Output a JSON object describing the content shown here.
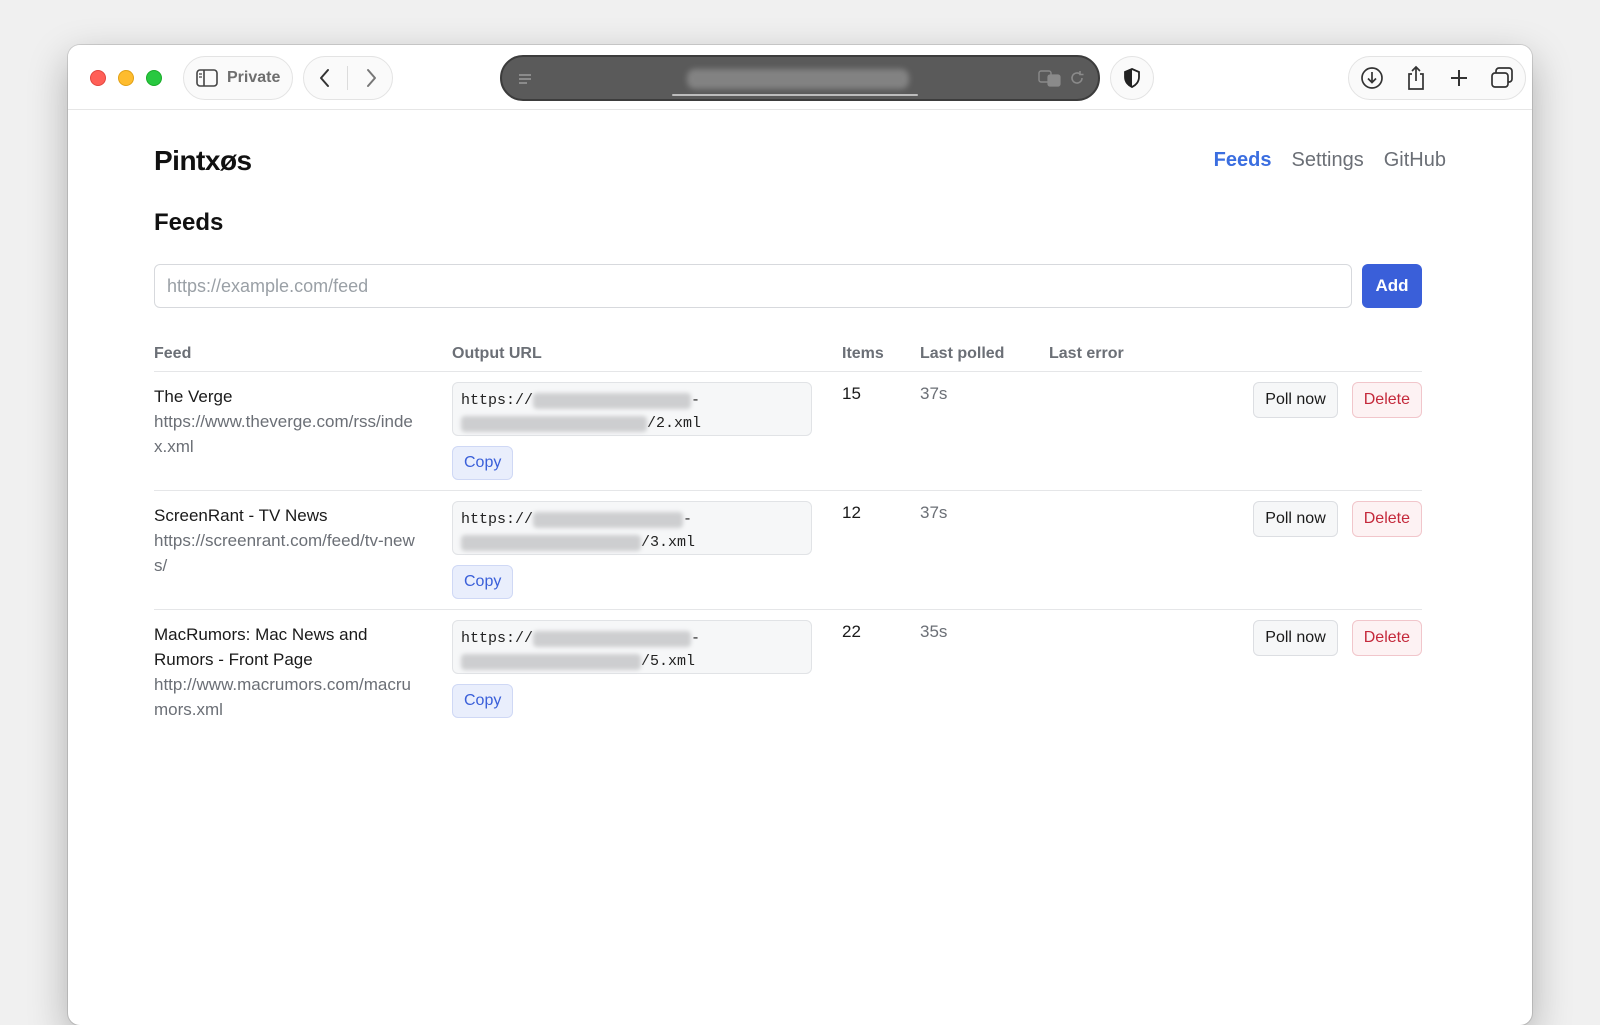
{
  "browser": {
    "private_label": "Private",
    "address_text": "",
    "icons": {
      "sidebar": "sidebar-icon",
      "back": "chevron-left-icon",
      "forward": "chevron-right-icon",
      "reader": "reader-menu-icon",
      "translate": "translate-icon",
      "reload": "reload-icon",
      "shield": "shield-icon",
      "download": "download-icon",
      "share": "share-icon",
      "new_tab": "plus-icon",
      "tabs": "tabs-overview-icon"
    }
  },
  "app": {
    "brand": "Pintxøs",
    "nav": [
      {
        "label": "Feeds",
        "active": true
      },
      {
        "label": "Settings",
        "active": false
      },
      {
        "label": "GitHub",
        "active": false
      }
    ]
  },
  "page": {
    "title": "Feeds",
    "input_placeholder": "https://example.com/feed",
    "input_value": "",
    "add_label": "Add",
    "accent_color": "#3a5fd9"
  },
  "table": {
    "headers": {
      "feed": "Feed",
      "output_url": "Output URL",
      "items": "Items",
      "last_polled": "Last polled",
      "last_error": "Last error"
    },
    "rows": [
      {
        "title": "The Verge",
        "url": "https://www.theverge.com/rss/index.xml",
        "output_prefix": "https://",
        "output_suffix": "2.xml",
        "line1_tail": "-",
        "copy_label": "Copy",
        "items": "15",
        "last_polled": "37s",
        "last_error": "",
        "poll_label": "Poll now",
        "delete_label": "Delete"
      },
      {
        "title": "ScreenRant - TV News",
        "url": "https://screenrant.com/feed/tv-news/",
        "output_prefix": "https://",
        "output_suffix": "3.xml",
        "line1_tail": "-",
        "copy_label": "Copy",
        "items": "12",
        "last_polled": "37s",
        "last_error": "",
        "poll_label": "Poll now",
        "delete_label": "Delete"
      },
      {
        "title": "MacRumors: Mac News and Rumors - Front Page",
        "url": "http://www.macrumors.com/macrumors.xml",
        "output_prefix": "https://",
        "output_suffix": "5.xml",
        "line1_tail": "-",
        "copy_label": "Copy",
        "items": "22",
        "last_polled": "35s",
        "last_error": "",
        "poll_label": "Poll now",
        "delete_label": "Delete"
      }
    ]
  }
}
